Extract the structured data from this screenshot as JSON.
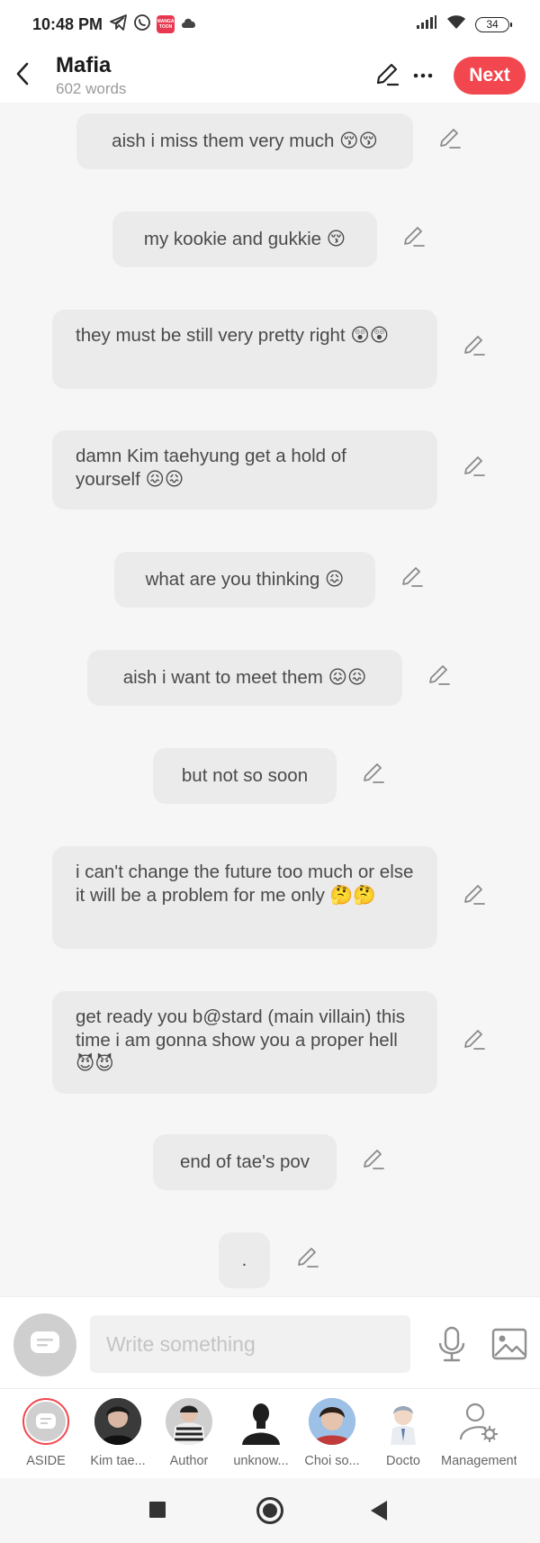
{
  "status_bar": {
    "time": "10:48 PM",
    "battery": "34",
    "app_badge": "MANGA TOON",
    "icons": [
      "telegram-icon",
      "whatsapp-icon",
      "mangatoon-icon",
      "cloud-icon",
      "signal-icon",
      "wifi-icon",
      "battery-icon"
    ]
  },
  "header": {
    "title": "Mafia",
    "subtitle": "602 words",
    "next_label": "Next",
    "accent_color": "#f2474e"
  },
  "messages": [
    {
      "text": "aish i miss them very much 😚😚"
    },
    {
      "text": "my kookie and gukkie 😚"
    },
    {
      "text": "they must be still very pretty right 😲😲"
    },
    {
      "text": "damn Kim taehyung get a hold of yourself 😖😖"
    },
    {
      "text": "what are you thinking 😖"
    },
    {
      "text": "aish i want to meet them 😖😖"
    },
    {
      "text": "but not so soon"
    },
    {
      "text": "i can't change the future too much or else it will be a problem for me only 🤔🤔"
    },
    {
      "text": "get ready you b@stard (main villain) this time i am gonna show you a proper hell 😈😈"
    },
    {
      "text": "end of tae's pov"
    },
    {
      "text": "."
    }
  ],
  "input": {
    "placeholder": "Write something",
    "value": ""
  },
  "characters": [
    {
      "label": "ASIDE"
    },
    {
      "label": "Kim tae..."
    },
    {
      "label": "Author"
    },
    {
      "label": "unknow..."
    },
    {
      "label": "Choi so..."
    },
    {
      "label": "Docto"
    },
    {
      "label": "Management"
    }
  ]
}
